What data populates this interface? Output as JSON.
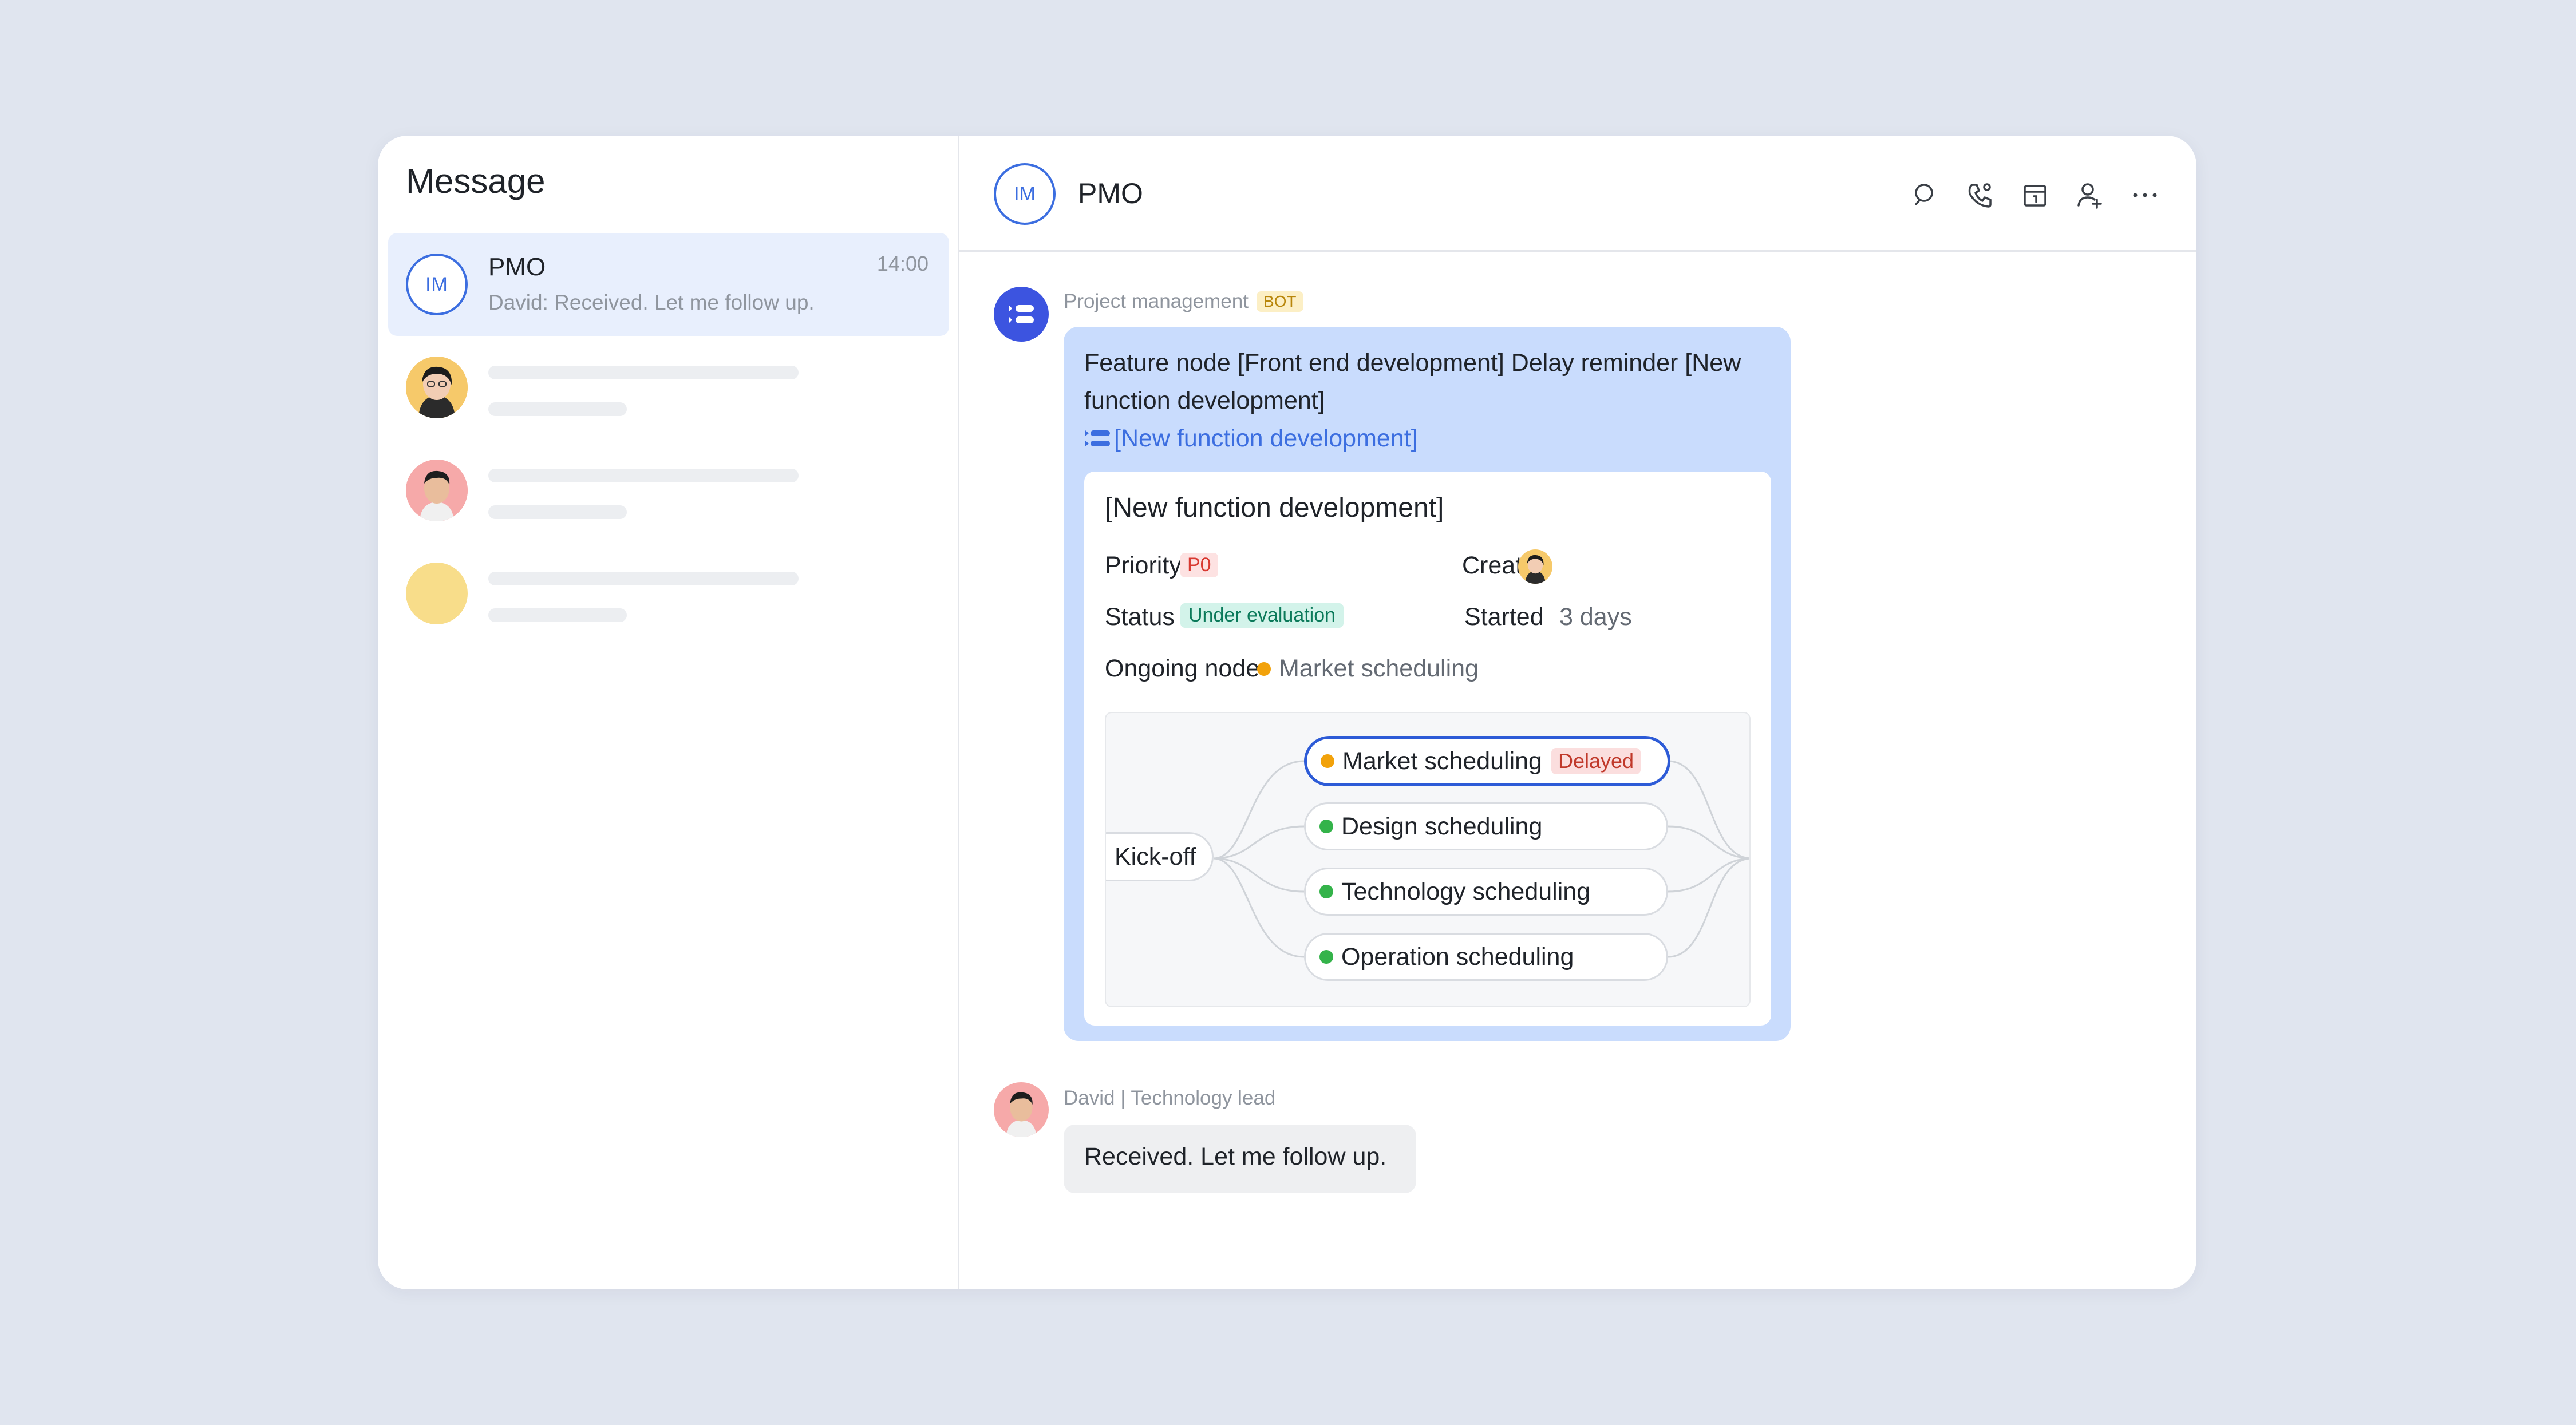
{
  "sidebar": {
    "title": "Message",
    "active_conversation": {
      "avatar_text": "IM",
      "name": "PMO",
      "time": "14:00",
      "preview": "David: Received. Let me follow up."
    }
  },
  "chat": {
    "header": {
      "avatar_text": "IM",
      "title": "PMO",
      "icons": [
        "search-icon",
        "phone-icon",
        "calendar-icon",
        "add-member-icon",
        "more-icon"
      ]
    },
    "bot_message": {
      "sender": "Project management",
      "tag": "BOT",
      "text": "Feature node [Front end development] Delay reminder [New function development]",
      "link": "[New function development]",
      "card": {
        "title": "[New function development]",
        "priority_label": "Priority",
        "priority_value": "P0",
        "creator_label": "Creator",
        "status_label": "Status",
        "status_value": "Under evaluation",
        "started_label": "Started",
        "started_value": "3 days",
        "ongoing_label": "Ongoing node",
        "ongoing_value": "Market scheduling",
        "flow": {
          "start": "Kick-off",
          "nodes": [
            {
              "label": "Market scheduling",
              "status": "orange",
              "tag": "Delayed"
            },
            {
              "label": "Design scheduling",
              "status": "green"
            },
            {
              "label": "Technology scheduling",
              "status": "green"
            },
            {
              "label": "Operation scheduling",
              "status": "green"
            }
          ]
        }
      }
    },
    "reply_message": {
      "sender": "David | Technology lead",
      "text": "Received. Let me follow up."
    }
  },
  "colors": {
    "background": "#e0e5ef",
    "accent": "#3c6ee0",
    "bubble": "#c9dcfd",
    "active_item": "#e8effd"
  }
}
